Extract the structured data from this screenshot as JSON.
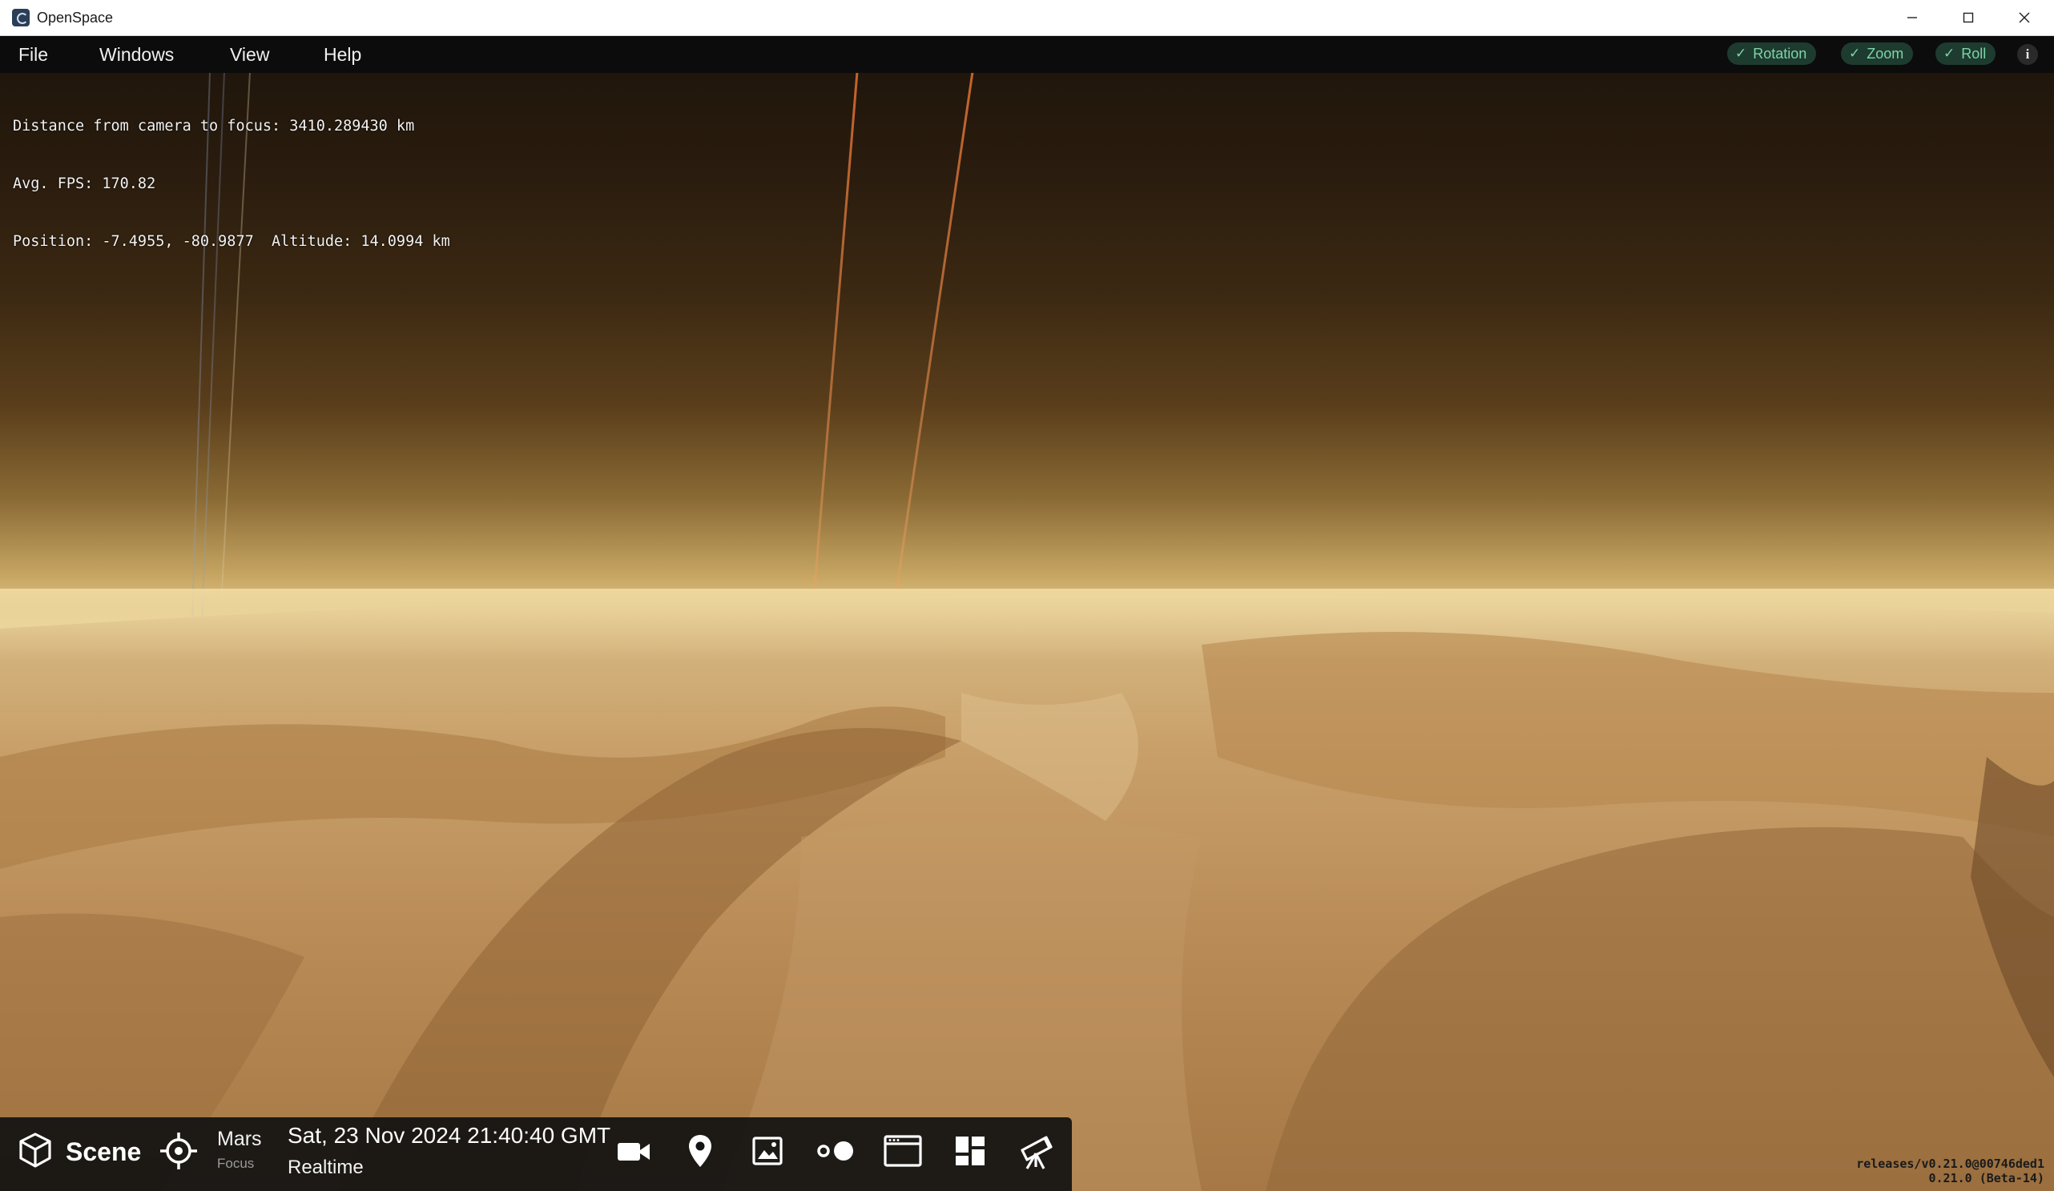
{
  "window": {
    "title": "OpenSpace",
    "controls": {
      "minimize": "—",
      "maximize": "☐",
      "close": "✕"
    }
  },
  "menubar": {
    "items": [
      "File",
      "Windows",
      "View",
      "Help"
    ]
  },
  "toggles": [
    {
      "label": "Rotation",
      "checked": true
    },
    {
      "label": "Zoom",
      "checked": true
    },
    {
      "label": "Roll",
      "checked": true
    }
  ],
  "info_button": "i",
  "stats": {
    "distance": "Distance from camera to focus: 3410.289430 km",
    "fps": "Avg. FPS: 170.82",
    "position": "Position: -7.4955, -80.9877  Altitude: 14.0994 km"
  },
  "bottombar": {
    "scene_label": "Scene",
    "focus_name": "Mars",
    "focus_sub": "Focus",
    "date": "Sat, 23 Nov 2024 21:40:40 GMT",
    "time_mode": "Realtime",
    "icons": [
      "scene-cube-icon",
      "focus-crosshair-icon",
      "camera-icon",
      "map-pin-icon",
      "image-icon",
      "flight-path-icon",
      "browser-window-icon",
      "dashboard-icon",
      "telescope-icon"
    ]
  },
  "version": {
    "line1": "releases/v0.21.0@00746ded1",
    "line2": "0.21.0 (Beta-14)"
  },
  "colors": {
    "accent_toggle_bg": "#1e3b30",
    "accent_toggle_fg": "#7dd4a8",
    "menubar_bg": "#0c0c0c",
    "bottombar_bg": "#121212"
  }
}
